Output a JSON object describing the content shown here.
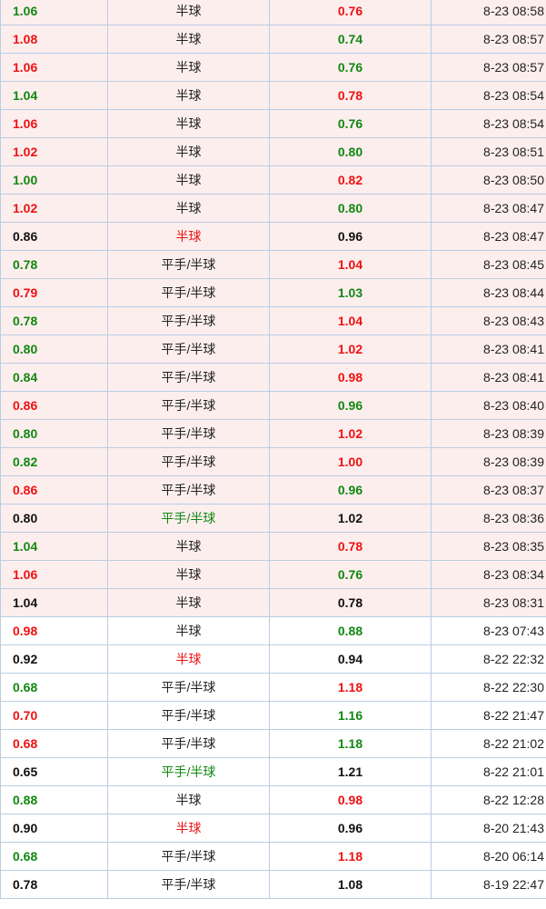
{
  "colors": {
    "red": "#ee1111",
    "green": "#118811",
    "black": "#111111",
    "pink_row_bg": "#fdeeee",
    "white_row_bg": "#ffffff",
    "border": "#b9cde3"
  },
  "rows": [
    {
      "home": "1.06",
      "home_color": "green",
      "line": "半球",
      "line_color": "default",
      "away": "0.76",
      "away_color": "red",
      "time": "8-23 08:58",
      "bg": "pink"
    },
    {
      "home": "1.08",
      "home_color": "red",
      "line": "半球",
      "line_color": "default",
      "away": "0.74",
      "away_color": "green",
      "time": "8-23 08:57",
      "bg": "pink"
    },
    {
      "home": "1.06",
      "home_color": "red",
      "line": "半球",
      "line_color": "default",
      "away": "0.76",
      "away_color": "green",
      "time": "8-23 08:57",
      "bg": "pink"
    },
    {
      "home": "1.04",
      "home_color": "green",
      "line": "半球",
      "line_color": "default",
      "away": "0.78",
      "away_color": "red",
      "time": "8-23 08:54",
      "bg": "pink"
    },
    {
      "home": "1.06",
      "home_color": "red",
      "line": "半球",
      "line_color": "default",
      "away": "0.76",
      "away_color": "green",
      "time": "8-23 08:54",
      "bg": "pink"
    },
    {
      "home": "1.02",
      "home_color": "red",
      "line": "半球",
      "line_color": "default",
      "away": "0.80",
      "away_color": "green",
      "time": "8-23 08:51",
      "bg": "pink"
    },
    {
      "home": "1.00",
      "home_color": "green",
      "line": "半球",
      "line_color": "default",
      "away": "0.82",
      "away_color": "red",
      "time": "8-23 08:50",
      "bg": "pink"
    },
    {
      "home": "1.02",
      "home_color": "red",
      "line": "半球",
      "line_color": "default",
      "away": "0.80",
      "away_color": "green",
      "time": "8-23 08:47",
      "bg": "pink"
    },
    {
      "home": "0.86",
      "home_color": "black",
      "line": "半球",
      "line_color": "red",
      "away": "0.96",
      "away_color": "black",
      "time": "8-23 08:47",
      "bg": "pink"
    },
    {
      "home": "0.78",
      "home_color": "green",
      "line": "平手/半球",
      "line_color": "default",
      "away": "1.04",
      "away_color": "red",
      "time": "8-23 08:45",
      "bg": "pink"
    },
    {
      "home": "0.79",
      "home_color": "red",
      "line": "平手/半球",
      "line_color": "default",
      "away": "1.03",
      "away_color": "green",
      "time": "8-23 08:44",
      "bg": "pink"
    },
    {
      "home": "0.78",
      "home_color": "green",
      "line": "平手/半球",
      "line_color": "default",
      "away": "1.04",
      "away_color": "red",
      "time": "8-23 08:43",
      "bg": "pink"
    },
    {
      "home": "0.80",
      "home_color": "green",
      "line": "平手/半球",
      "line_color": "default",
      "away": "1.02",
      "away_color": "red",
      "time": "8-23 08:41",
      "bg": "pink"
    },
    {
      "home": "0.84",
      "home_color": "green",
      "line": "平手/半球",
      "line_color": "default",
      "away": "0.98",
      "away_color": "red",
      "time": "8-23 08:41",
      "bg": "pink"
    },
    {
      "home": "0.86",
      "home_color": "red",
      "line": "平手/半球",
      "line_color": "default",
      "away": "0.96",
      "away_color": "green",
      "time": "8-23 08:40",
      "bg": "pink"
    },
    {
      "home": "0.80",
      "home_color": "green",
      "line": "平手/半球",
      "line_color": "default",
      "away": "1.02",
      "away_color": "red",
      "time": "8-23 08:39",
      "bg": "pink"
    },
    {
      "home": "0.82",
      "home_color": "green",
      "line": "平手/半球",
      "line_color": "default",
      "away": "1.00",
      "away_color": "red",
      "time": "8-23 08:39",
      "bg": "pink"
    },
    {
      "home": "0.86",
      "home_color": "red",
      "line": "平手/半球",
      "line_color": "default",
      "away": "0.96",
      "away_color": "green",
      "time": "8-23 08:37",
      "bg": "pink"
    },
    {
      "home": "0.80",
      "home_color": "black",
      "line": "平手/半球",
      "line_color": "green",
      "away": "1.02",
      "away_color": "black",
      "time": "8-23 08:36",
      "bg": "pink"
    },
    {
      "home": "1.04",
      "home_color": "green",
      "line": "半球",
      "line_color": "default",
      "away": "0.78",
      "away_color": "red",
      "time": "8-23 08:35",
      "bg": "pink"
    },
    {
      "home": "1.06",
      "home_color": "red",
      "line": "半球",
      "line_color": "default",
      "away": "0.76",
      "away_color": "green",
      "time": "8-23 08:34",
      "bg": "pink"
    },
    {
      "home": "1.04",
      "home_color": "black",
      "line": "半球",
      "line_color": "default",
      "away": "0.78",
      "away_color": "black",
      "time": "8-23 08:31",
      "bg": "pink"
    },
    {
      "home": "0.98",
      "home_color": "red",
      "line": "半球",
      "line_color": "default",
      "away": "0.88",
      "away_color": "green",
      "time": "8-23 07:43",
      "bg": "white"
    },
    {
      "home": "0.92",
      "home_color": "black",
      "line": "半球",
      "line_color": "red",
      "away": "0.94",
      "away_color": "black",
      "time": "8-22 22:32",
      "bg": "white"
    },
    {
      "home": "0.68",
      "home_color": "green",
      "line": "平手/半球",
      "line_color": "default",
      "away": "1.18",
      "away_color": "red",
      "time": "8-22 22:30",
      "bg": "white"
    },
    {
      "home": "0.70",
      "home_color": "red",
      "line": "平手/半球",
      "line_color": "default",
      "away": "1.16",
      "away_color": "green",
      "time": "8-22 21:47",
      "bg": "white"
    },
    {
      "home": "0.68",
      "home_color": "red",
      "line": "平手/半球",
      "line_color": "default",
      "away": "1.18",
      "away_color": "green",
      "time": "8-22 21:02",
      "bg": "white"
    },
    {
      "home": "0.65",
      "home_color": "black",
      "line": "平手/半球",
      "line_color": "green",
      "away": "1.21",
      "away_color": "black",
      "time": "8-22 21:01",
      "bg": "white"
    },
    {
      "home": "0.88",
      "home_color": "green",
      "line": "半球",
      "line_color": "default",
      "away": "0.98",
      "away_color": "red",
      "time": "8-22 12:28",
      "bg": "white"
    },
    {
      "home": "0.90",
      "home_color": "black",
      "line": "半球",
      "line_color": "red",
      "away": "0.96",
      "away_color": "black",
      "time": "8-20 21:43",
      "bg": "white"
    },
    {
      "home": "0.68",
      "home_color": "green",
      "line": "平手/半球",
      "line_color": "default",
      "away": "1.18",
      "away_color": "red",
      "time": "8-20 06:14",
      "bg": "white"
    },
    {
      "home": "0.78",
      "home_color": "black",
      "line": "平手/半球",
      "line_color": "default",
      "away": "1.08",
      "away_color": "black",
      "time": "8-19 22:47",
      "bg": "white"
    }
  ]
}
